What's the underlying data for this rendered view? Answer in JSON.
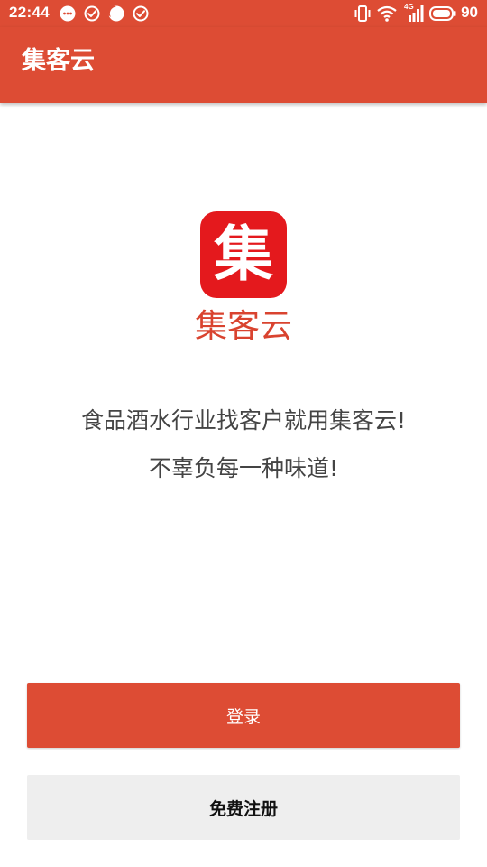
{
  "status_bar": {
    "time": "22:44",
    "notification_icons": [
      "chat-bubble-icon",
      "check-circle-icon",
      "half-moon-icon",
      "check-circle-icon"
    ],
    "right_icons": [
      "vibrate-icon",
      "wifi-icon",
      "signal-4g-icon",
      "battery-icon"
    ],
    "network_label": "4G",
    "battery_level": "90"
  },
  "app_bar": {
    "title": "集客云"
  },
  "logo": {
    "glyph": "集",
    "icon": "app-logo-icon",
    "background_color": "#e4191d"
  },
  "brand_name": "集客云",
  "slogan": {
    "line1": "食品酒水行业找客户就用集客云!",
    "line2": "不辜负每一种味道!"
  },
  "buttons": {
    "login": "登录",
    "register": "免费注册"
  },
  "colors": {
    "accent": "#dd4c34",
    "brand_text": "#d9432f",
    "secondary_button": "#eeeeee"
  }
}
